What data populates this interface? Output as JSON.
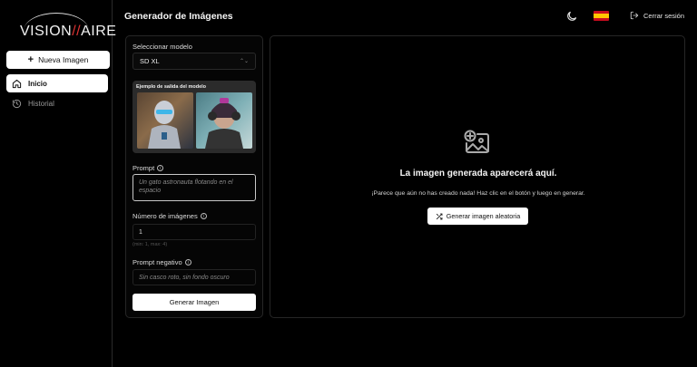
{
  "brand": {
    "logo_prefix": "VISION",
    "logo_accent": "//",
    "logo_suffix": "AIRE"
  },
  "sidebar": {
    "new_image_label": "Nueva Imagen",
    "items": [
      {
        "label": "Inicio",
        "icon": "home-icon",
        "active": true
      },
      {
        "label": "Historial",
        "icon": "history-icon",
        "active": false
      }
    ]
  },
  "header": {
    "title": "Generador de Imágenes",
    "logout_label": "Cerrar sesión",
    "language_flag": "es"
  },
  "form": {
    "model_label": "Seleccionar modelo",
    "model_value": "SD XL",
    "example_label": "Ejemplo de salida del modelo",
    "prompt_label": "Prompt",
    "prompt_placeholder": "Un gato astronauta flotando en el espacio",
    "num_images_label": "Número de imágenes",
    "num_images_value": "1",
    "num_images_hint": "(min: 1, max: 4)",
    "negative_label": "Prompt negativo",
    "negative_placeholder": "Sin casco roto, sin fondo oscuro",
    "generate_label": "Generar Imagen"
  },
  "output": {
    "title": "La imagen generada aparecerá aquí.",
    "subtitle": "¡Parece que aún no has creado nada! Haz clic en el botón y luego en generar.",
    "random_label": "Generar imagen aleatoria"
  },
  "colors": {
    "background": "#000000",
    "panel_border": "#262626",
    "button_bg": "#ffffff",
    "logo_accent": "#dd3333",
    "flag_red": "#c60b1e",
    "flag_yellow": "#ffc400"
  }
}
